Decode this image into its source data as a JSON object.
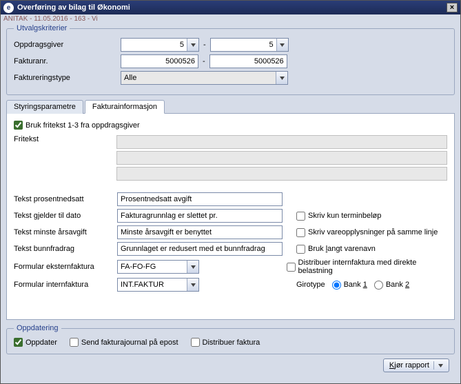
{
  "window": {
    "title": "Overføring av bilag til Økonomi",
    "subtitle": "ANITAK - 11.05.2016 - 163 - Vi",
    "close": "×"
  },
  "utvalg": {
    "legend": "Utvalgskriterier",
    "oppdragsgiver_label": "Oppdragsgiver",
    "oppdragsgiver_from": "5",
    "oppdragsgiver_to": "5",
    "fakturanr_label": "Fakturanr.",
    "fakturanr_from": "5000526",
    "fakturanr_to": "5000526",
    "faktureringstype_label": "Faktureringstype",
    "faktureringstype_value": "Alle"
  },
  "tabs": {
    "styring": "Styringsparametre",
    "faktura": "Fakturainformasjon"
  },
  "faktura": {
    "bruk_fritekst": "Bruk fritekst 1-3 fra oppdragsgiver",
    "fritekst_label": "Fritekst",
    "fritekst1": "",
    "fritekst2": "",
    "fritekst3": "",
    "tekst_prosent_label": "Tekst prosentnedsatt",
    "tekst_prosent_value": "Prosentnedsatt avgift",
    "tekst_gjelder_label": "Tekst gjelder til dato",
    "tekst_gjelder_value": "Fakturagrunnlag er slettet pr.",
    "tekst_minste_label": "Tekst minste årsavgift",
    "tekst_minste_value": "Minste årsavgift er benyttet",
    "tekst_bunn_label": "Tekst bunnfradrag",
    "tekst_bunn_value": "Grunnlaget er redusert med et bunnfradrag",
    "formular_ekstern_label": "Formular eksternfaktura",
    "formular_ekstern_value": "FA-FO-FG",
    "formular_intern_label": "Formular internfaktura",
    "formular_intern_value": "INT.FAKTUR",
    "skriv_termin": "Skriv kun terminbeløp",
    "skriv_vareopp": "Skriv vareopplysninger på samme linje",
    "bruk_langt_pre": "Bruk ",
    "bruk_langt_u": "l",
    "bruk_langt_post": "angt varenavn",
    "distribuer_intern": "Distribuer internfaktura med direkte belastning",
    "girotype_label": "Girotype",
    "bank1_pre": "Bank ",
    "bank1_u": "1",
    "bank2_pre": "Bank ",
    "bank2_u": "2"
  },
  "oppdatering": {
    "legend": "Oppdatering",
    "oppdater": "Oppdater",
    "send_journal": "Send fakturajournal på epost",
    "distribuer_faktura": "Distribuer faktura"
  },
  "footer": {
    "run_pre": "",
    "run_u": "K",
    "run_post": "jør rapport"
  }
}
